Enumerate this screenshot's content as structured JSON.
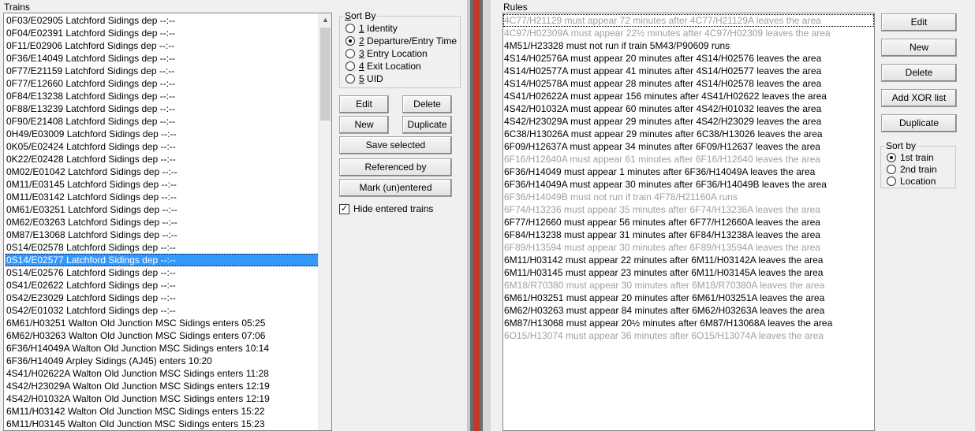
{
  "trains_panel": {
    "label": "Trains",
    "items": [
      {
        "text": "0F03/E02905 Latchford Sidings dep --:--",
        "selected": false
      },
      {
        "text": "0F04/E02391 Latchford Sidings dep --:--",
        "selected": false
      },
      {
        "text": "0F11/E02906 Latchford Sidings dep --:--",
        "selected": false
      },
      {
        "text": "0F36/E14049 Latchford Sidings dep --:--",
        "selected": false
      },
      {
        "text": "0F77/E21159 Latchford Sidings dep --:--",
        "selected": false
      },
      {
        "text": "0F77/E12660 Latchford Sidings dep --:--",
        "selected": false
      },
      {
        "text": "0F84/E13238 Latchford Sidings dep --:--",
        "selected": false
      },
      {
        "text": "0F88/E13239 Latchford Sidings dep --:--",
        "selected": false
      },
      {
        "text": "0F90/E21408 Latchford Sidings dep --:--",
        "selected": false
      },
      {
        "text": "0H49/E03009 Latchford Sidings dep --:--",
        "selected": false
      },
      {
        "text": "0K05/E02424 Latchford Sidings dep --:--",
        "selected": false
      },
      {
        "text": "0K22/E02428 Latchford Sidings dep --:--",
        "selected": false
      },
      {
        "text": "0M02/E01042 Latchford Sidings dep --:--",
        "selected": false
      },
      {
        "text": "0M11/E03145 Latchford Sidings dep --:--",
        "selected": false
      },
      {
        "text": "0M11/E03142 Latchford Sidings dep --:--",
        "selected": false
      },
      {
        "text": "0M61/E03251 Latchford Sidings dep --:--",
        "selected": false
      },
      {
        "text": "0M62/E03263 Latchford Sidings dep --:--",
        "selected": false
      },
      {
        "text": "0M87/E13068 Latchford Sidings dep --:--",
        "selected": false
      },
      {
        "text": "0S14/E02578 Latchford Sidings dep --:--",
        "selected": false
      },
      {
        "text": "0S14/E02577 Latchford Sidings dep --:--",
        "selected": true
      },
      {
        "text": "0S14/E02576 Latchford Sidings dep --:--",
        "selected": false
      },
      {
        "text": "0S41/E02622 Latchford Sidings dep --:--",
        "selected": false
      },
      {
        "text": "0S42/E23029 Latchford Sidings dep --:--",
        "selected": false
      },
      {
        "text": "0S42/E01032 Latchford Sidings dep --:--",
        "selected": false
      },
      {
        "text": "6M61/H03251 Walton Old Junction MSC Sidings enters 05:25",
        "selected": false
      },
      {
        "text": "6M62/H03263 Walton Old Junction MSC Sidings enters 07:06",
        "selected": false
      },
      {
        "text": "6F36/H14049A Walton Old Junction MSC Sidings enters 10:14",
        "selected": false
      },
      {
        "text": "6F36/H14049 Arpley Sidings (AJ45) enters 10:20",
        "selected": false
      },
      {
        "text": "4S41/H02622A Walton Old Junction MSC Sidings enters 11:28",
        "selected": false
      },
      {
        "text": "4S42/H23029A Walton Old Junction MSC Sidings enters 12:19",
        "selected": false
      },
      {
        "text": "4S42/H01032A Walton Old Junction MSC Sidings enters 12:19",
        "selected": false
      },
      {
        "text": "6M11/H03142 Walton Old Junction MSC Sidings enters 15:22",
        "selected": false
      },
      {
        "text": "6M11/H03145 Walton Old Junction MSC Sidings enters 15:23",
        "selected": false
      }
    ]
  },
  "sort_by": {
    "title_prefix": "S",
    "title_rest": "ort By",
    "options": [
      {
        "key": "1",
        "label": " Identity",
        "checked": false
      },
      {
        "key": "2",
        "label": " Departure/Entry Time",
        "checked": true
      },
      {
        "key": "3",
        "label": " Entry Location",
        "checked": false
      },
      {
        "key": "4",
        "label": " Exit Location",
        "checked": false
      },
      {
        "key": "5",
        "label": " UID",
        "checked": false
      }
    ]
  },
  "train_buttons": {
    "edit": "Edit",
    "delete": "Delete",
    "new": "New",
    "duplicate": "Duplicate",
    "save_selected": "Save selected",
    "referenced_by": "Referenced by",
    "mark_unentered": "Mark (un)entered"
  },
  "hide_entered": {
    "label": "Hide entered trains",
    "checked": true
  },
  "rules_panel": {
    "label": "Rules",
    "items": [
      {
        "text": "4C77/H21129 must appear 72 minutes after 4C77/H21129A leaves the area",
        "enabled": false
      },
      {
        "text": "4C97/H02309A must appear 22½ minutes after 4C97/H02309 leaves the area",
        "enabled": false
      },
      {
        "text": "4M51/H23328 must not run if train 5M43/P90609 runs",
        "enabled": true
      },
      {
        "text": "4S14/H02576A must appear 20 minutes after 4S14/H02576 leaves the area",
        "enabled": true
      },
      {
        "text": "4S14/H02577A must appear 41 minutes after 4S14/H02577 leaves the area",
        "enabled": true
      },
      {
        "text": "4S14/H02578A must appear 28 minutes after 4S14/H02578 leaves the area",
        "enabled": true
      },
      {
        "text": "4S41/H02622A must appear 156 minutes after 4S41/H02622 leaves the area",
        "enabled": true
      },
      {
        "text": "4S42/H01032A must appear 60 minutes after 4S42/H01032 leaves the area",
        "enabled": true
      },
      {
        "text": "4S42/H23029A must appear 29 minutes after 4S42/H23029 leaves the area",
        "enabled": true
      },
      {
        "text": "6C38/H13026A must appear 29 minutes after 6C38/H13026 leaves the area",
        "enabled": true
      },
      {
        "text": "6F09/H12637A must appear 34 minutes after 6F09/H12637 leaves the area",
        "enabled": true
      },
      {
        "text": "6F16/H12640A must appear 61 minutes after 6F16/H12640 leaves the area",
        "enabled": false
      },
      {
        "text": "6F36/H14049 must appear 1 minutes after 6F36/H14049A leaves the area",
        "enabled": true
      },
      {
        "text": "6F36/H14049A must appear 30 minutes after 6F36/H14049B leaves the area",
        "enabled": true
      },
      {
        "text": "6F36/H14049B must not run if train 4F78/H21160A runs",
        "enabled": false
      },
      {
        "text": "6F74/H13236 must appear 35 minutes after 6F74/H13236A leaves the area",
        "enabled": false
      },
      {
        "text": "6F77/H12660 must appear 56 minutes after 6F77/H12660A leaves the area",
        "enabled": true
      },
      {
        "text": "6F84/H13238 must appear 31 minutes after 6F84/H13238A leaves the area",
        "enabled": true
      },
      {
        "text": "6F89/H13594 must appear 30 minutes after 6F89/H13594A leaves the area",
        "enabled": false
      },
      {
        "text": "6M11/H03142 must appear 22 minutes after 6M11/H03142A leaves the area",
        "enabled": true
      },
      {
        "text": "6M11/H03145 must appear 23 minutes after 6M11/H03145A leaves the area",
        "enabled": true
      },
      {
        "text": "6M18/R70380 must appear 30 minutes after 6M18/R70380A leaves the area",
        "enabled": false
      },
      {
        "text": "6M61/H03251 must appear 20 minutes after 6M61/H03251A leaves the area",
        "enabled": true
      },
      {
        "text": "6M62/H03263 must appear 84 minutes after 6M62/H03263A leaves the area",
        "enabled": true
      },
      {
        "text": "6M87/H13068 must appear 20½ minutes after 6M87/H13068A leaves the area",
        "enabled": true
      },
      {
        "text": "6O15/H13074 must appear 36 minutes after 6O15/H13074A leaves the area",
        "enabled": false
      }
    ]
  },
  "rule_buttons": {
    "edit": "Edit",
    "new": "New",
    "delete": "Delete",
    "add_xor": "Add XOR list",
    "duplicate": "Duplicate"
  },
  "rule_sort": {
    "title": "Sort by",
    "options": [
      {
        "label": "1st train",
        "checked": true
      },
      {
        "label": "2nd train",
        "checked": false
      },
      {
        "label": "Location",
        "checked": false
      }
    ]
  },
  "colors": {
    "selection": "#3399ff",
    "disabled_text": "#a0a0a0",
    "splitter_red": "#c0392b"
  }
}
